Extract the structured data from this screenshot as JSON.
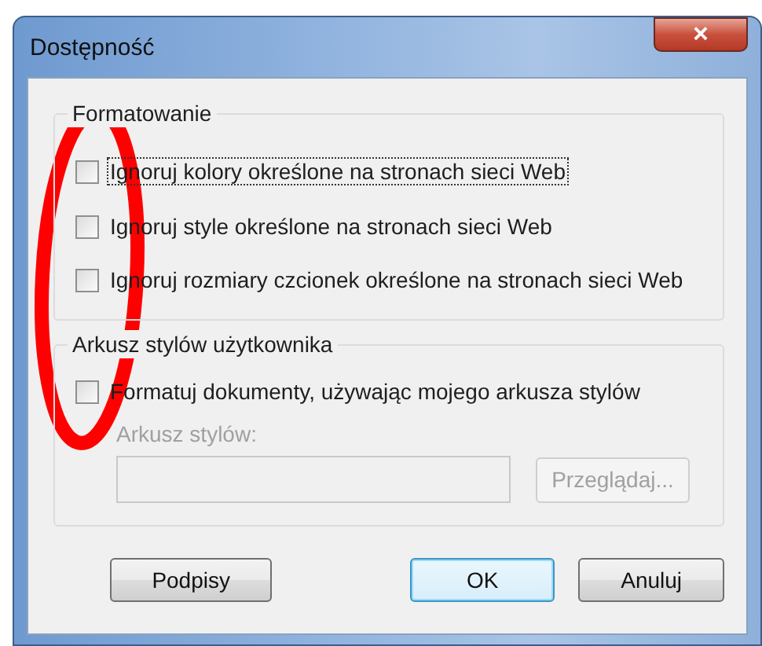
{
  "window": {
    "title": "Dostępność",
    "close": "×"
  },
  "groups": [
    {
      "legend": "Formatowanie",
      "options": [
        {
          "label": "Ignoruj kolory określone na stronach sieci Web",
          "checked": false,
          "focused": true
        },
        {
          "label": "Ignoruj style określone na stronach sieci Web",
          "checked": false,
          "focused": false
        },
        {
          "label": "Ignoruj rozmiary czcionek określone na stronach sieci Web",
          "checked": false,
          "focused": false
        }
      ]
    },
    {
      "legend": "Arkusz stylów użytkownika",
      "options": [
        {
          "label": "Formatuj dokumenty, używając mojego arkusza stylów",
          "checked": false,
          "focused": false
        }
      ],
      "field": {
        "label": "Arkusz stylów:",
        "disabled": true,
        "browse_button": "Przeglądaj..."
      }
    }
  ],
  "buttons": [
    {
      "label": "Podpisy",
      "default": false
    },
    {
      "label": "OK",
      "default": true
    },
    {
      "label": "Anuluj",
      "default": false
    }
  ],
  "annotation": {
    "kind": "ellipse"
  }
}
